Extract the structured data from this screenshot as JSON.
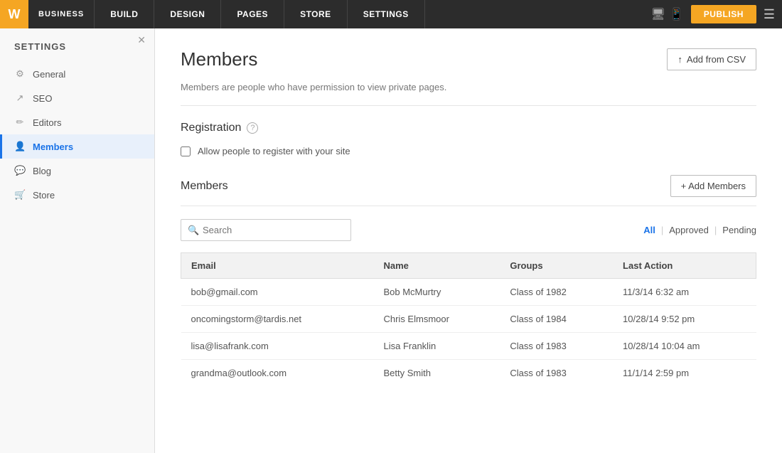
{
  "topNav": {
    "logo": "W",
    "brand": "BUSINESS",
    "items": [
      {
        "label": "BUILD",
        "id": "build"
      },
      {
        "label": "DESIGN",
        "id": "design"
      },
      {
        "label": "PAGES",
        "id": "pages"
      },
      {
        "label": "STORE",
        "id": "store"
      },
      {
        "label": "SETTINGS",
        "id": "settings"
      }
    ],
    "publish_label": "PUBLISH",
    "menu_icon": "☰"
  },
  "sidebar": {
    "title": "SETTINGS",
    "items": [
      {
        "label": "General",
        "icon": "⚙",
        "id": "general",
        "active": false
      },
      {
        "label": "SEO",
        "icon": "📈",
        "id": "seo",
        "active": false
      },
      {
        "label": "Editors",
        "icon": "✏",
        "id": "editors",
        "active": false
      },
      {
        "label": "Members",
        "icon": "👤",
        "id": "members",
        "active": true
      },
      {
        "label": "Blog",
        "icon": "💬",
        "id": "blog",
        "active": false
      },
      {
        "label": "Store",
        "icon": "🛒",
        "id": "store",
        "active": false
      }
    ]
  },
  "main": {
    "page_title": "Members",
    "add_csv_btn": "Add from CSV",
    "description": "Members are people who have permission to view private pages.",
    "registration": {
      "heading": "Registration",
      "checkbox_label": "Allow people to register with your site",
      "checked": false
    },
    "members_section": {
      "heading": "Members",
      "add_members_btn": "+ Add Members",
      "search_placeholder": "Search",
      "filters": [
        {
          "label": "All",
          "active": true
        },
        {
          "label": "Approved",
          "active": false
        },
        {
          "label": "Pending",
          "active": false
        }
      ],
      "table_headers": [
        "Email",
        "Name",
        "Groups",
        "Last Action"
      ],
      "rows": [
        {
          "email": "bob@gmail.com",
          "name": "Bob McMurtry",
          "groups": "Class of 1982",
          "last_action": "11/3/14 6:32 am"
        },
        {
          "email": "oncomingstorm@tardis.net",
          "name": "Chris Elmsmoor",
          "groups": "Class of 1984",
          "last_action": "10/28/14 9:52 pm"
        },
        {
          "email": "lisa@lisafrank.com",
          "name": "Lisa Franklin",
          "groups": "Class of 1983",
          "last_action": "10/28/14 10:04 am"
        },
        {
          "email": "grandma@outlook.com",
          "name": "Betty Smith",
          "groups": "Class of 1983",
          "last_action": "11/1/14 2:59 pm"
        }
      ]
    }
  }
}
